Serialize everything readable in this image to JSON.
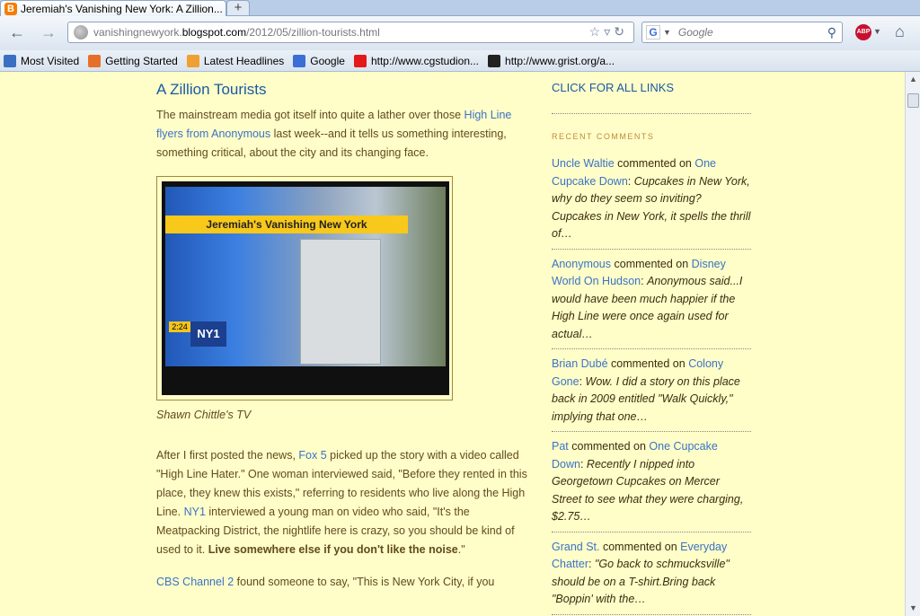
{
  "browser": {
    "tab_title": "Jeremiah's Vanishing New York: A Zillion...",
    "tab_close": "×",
    "new_tab": "+",
    "url_prefix": "vanishingnewyork.",
    "url_domain": "blogspot.com",
    "url_path": "/2012/05/zillion-tourists.html",
    "search_placeholder": "Google",
    "abp_label": "ABP"
  },
  "bookmarks": [
    {
      "label": "Most Visited",
      "icon": "most-visited-icon",
      "color": "#3b6fc4"
    },
    {
      "label": "Getting Started",
      "icon": "firefox-icon",
      "color": "#e6702a"
    },
    {
      "label": "Latest Headlines",
      "icon": "rss-icon",
      "color": "#f0a030"
    },
    {
      "label": "Google",
      "icon": "google-icon",
      "color": "#3b6fd6"
    },
    {
      "label": "http://www.cgstudion...",
      "icon": "red-square-icon",
      "color": "#e21a1a"
    },
    {
      "label": "http://www.grist.org/a...",
      "icon": "grist-icon",
      "color": "#222222"
    }
  ],
  "post": {
    "title": "A Zillion Tourists",
    "p1_a": "The mainstream media got itself into quite a lather over those ",
    "p1_link": "High Line flyers from Anonymous",
    "p1_b": " last week--and it tells us something interesting, something critical, about the city and its changing face.",
    "tv_banner": "Jeremiah's Vanishing New York",
    "tv_logo": "NY1",
    "tv_time": "2:24",
    "caption": "Shawn Chittle's TV",
    "p2_a": "After I first posted the news, ",
    "p2_link1": "Fox 5",
    "p2_b": " picked up the story with a video called \"High Line Hater.\" One woman interviewed said, \"Before they rented in this place, they knew this exists,\" referring to residents who live along the High Line. ",
    "p2_link2": "NY1",
    "p2_c": " interviewed a young man on video who said, \"It's the Meatpacking District, the nightlife here is crazy, so you should be kind of used to it. ",
    "p2_bold": "Live somewhere else if you don't like the noise",
    "p2_d": ".\"",
    "p3_link": "CBS Channel 2",
    "p3_a": " found someone to say, \"This is New York City, if you"
  },
  "sidebar": {
    "all_links": "CLICK FOR ALL LINKS",
    "recent_heading": "RECENT COMMENTS",
    "commented_on": " commented on ",
    "comments": [
      {
        "author": "Uncle Waltie",
        "post": "One Cupcake Down",
        "snippet": "Cupcakes in New York, why do they seem so inviting?Cupcakes in New York, it spells the thrill of…"
      },
      {
        "author": "Anonymous",
        "post": "Disney World On Hudson",
        "snippet": "Anonymous said...I would have been much happier if the High Line were once again used for actual…"
      },
      {
        "author": "Brian Dubé",
        "post": "Colony Gone",
        "snippet": "Wow. I did a story on this place back in 2009 entitled \"Walk Quickly,\" implying that one…"
      },
      {
        "author": "Pat",
        "post": "One Cupcake Down",
        "snippet": "Recently I nipped into Georgetown Cupcakes on Mercer Street to see what they were charging, $2.75…"
      },
      {
        "author": "Grand St.",
        "post": "Everyday Chatter",
        "snippet": "\"Go back to schmucksville\" should be on a T-shirt.Bring back \"Boppin' with the…"
      }
    ]
  }
}
